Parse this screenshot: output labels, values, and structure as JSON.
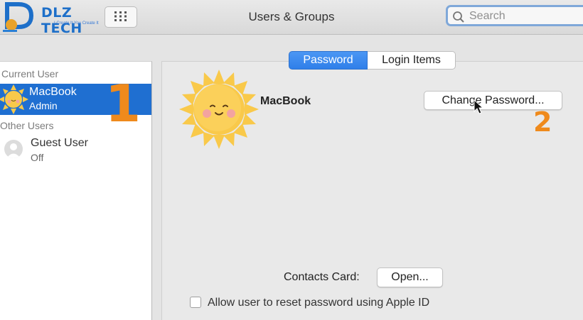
{
  "logo": {
    "text": "DLZ TECH",
    "tagline": "I Create It You Create It"
  },
  "window": {
    "title": "Users & Groups"
  },
  "toolbar": {
    "grid_icon": "grid-icon"
  },
  "search": {
    "placeholder": "Search"
  },
  "sidebar": {
    "current_user_label": "Current User",
    "current_user": {
      "name": "MacBook",
      "role": "Admin"
    },
    "other_users_label": "Other Users",
    "guest": {
      "name": "Guest User",
      "status": "Off"
    }
  },
  "tabs": [
    {
      "label": "Password",
      "active": true
    },
    {
      "label": "Login Items",
      "active": false
    }
  ],
  "profile": {
    "name": "MacBook",
    "change_password_label": "Change Password..."
  },
  "contacts": {
    "label": "Contacts Card:",
    "open_label": "Open..."
  },
  "reset_option": {
    "label": "Allow user to reset password using Apple ID",
    "checked": false
  },
  "annotations": {
    "step1": "1",
    "step2": "2"
  },
  "colors": {
    "accent": "#2f7fe9",
    "selection": "#1f6fd1",
    "annotation": "#ef8a1c",
    "sun": "#f9c94a"
  }
}
